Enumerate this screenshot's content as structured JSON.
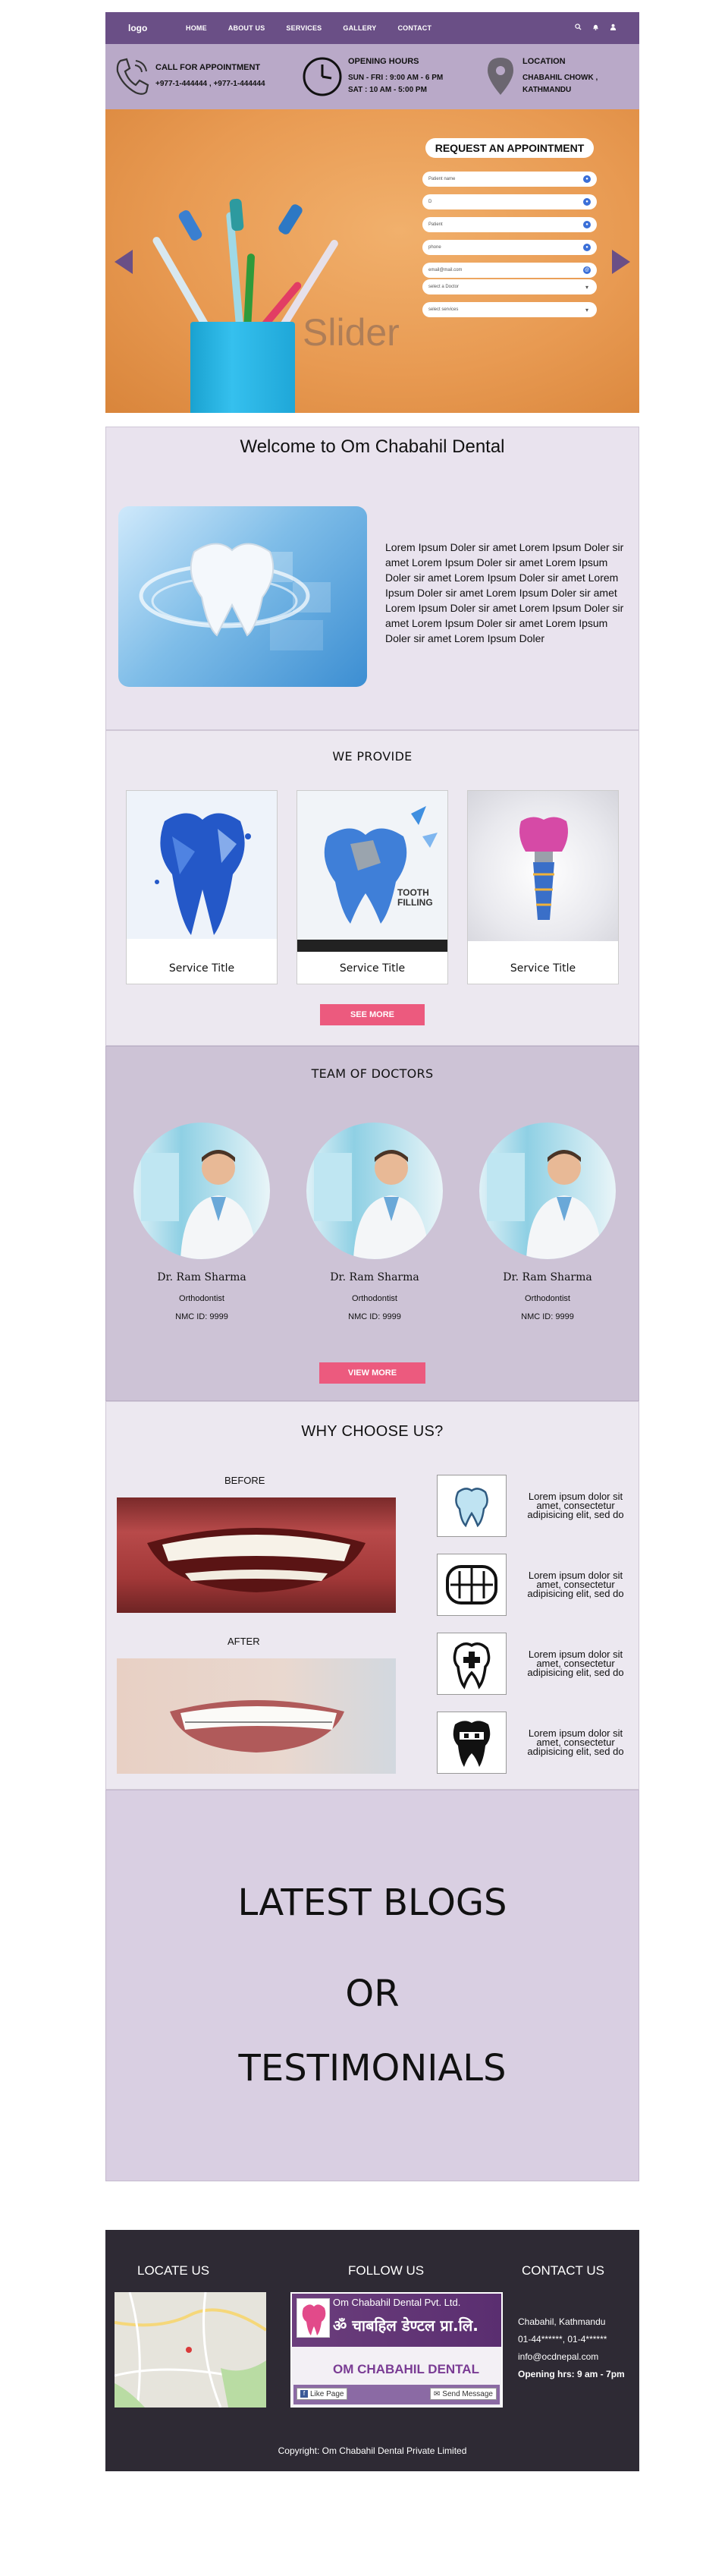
{
  "nav": {
    "logo": "logo",
    "menu": [
      "HOME",
      "ABOUT US",
      "SERVICES",
      "GALLERY",
      "CONTACT"
    ],
    "icons": [
      "search-icon",
      "bell-icon",
      "user-icon"
    ],
    "bg_color": "#6a4f86"
  },
  "info": {
    "call": {
      "title": "CALL FOR APPOINTMENT",
      "line1": "+977-1-444444 , +977-1-444444"
    },
    "hours": {
      "title": "OPENING HOURS",
      "line1": "SUN - FRI : 9:00 AM - 6 PM",
      "line2": "SAT : 10 AM - 5:00 PM"
    },
    "location": {
      "title": "LOCATION",
      "line1": "CHABAHIL CHOWK ,",
      "line2": "KATHMANDU"
    }
  },
  "hero": {
    "slider_label": "Slider",
    "appointment": {
      "heading": "REQUEST AN APPOINTMENT",
      "fields": [
        {
          "placeholder": "Patient name"
        },
        {
          "placeholder": "D"
        },
        {
          "placeholder": "Patient"
        },
        {
          "placeholder": "phone"
        },
        {
          "placeholder": "email@mail.com"
        }
      ],
      "hint": "",
      "selects": [
        {
          "value": "select a Doctor"
        },
        {
          "value": "select services"
        }
      ]
    }
  },
  "welcome": {
    "title": "Welcome to Om Chabahil Dental",
    "body": "Lorem Ipsum Doler sir amet Lorem Ipsum Doler sir amet Lorem Ipsum Doler sir amet Lorem Ipsum Doler sir amet Lorem Ipsum Doler sir amet Lorem Ipsum Doler sir amet Lorem Ipsum Doler sir amet Lorem Ipsum Doler sir amet Lorem Ipsum Doler sir amet Lorem Ipsum Doler sir amet Lorem Ipsum Doler sir amet Lorem Ipsum Doler"
  },
  "provide": {
    "title": "WE PROVIDE",
    "cards": [
      {
        "title": "Service Title",
        "image_caption": ""
      },
      {
        "title": "Service Title",
        "image_caption": "TOOTH FILLING"
      },
      {
        "title": "Service Title",
        "image_caption": ""
      }
    ],
    "button": "SEE MORE"
  },
  "team": {
    "title": "TEAM OF DOCTORS",
    "doctors": [
      {
        "name": "Dr. Ram Sharma",
        "specialty": "Orthodontist",
        "nmc": "NMC ID: 9999"
      },
      {
        "name": "Dr. Ram Sharma",
        "specialty": "Orthodontist",
        "nmc": "NMC ID: 9999"
      },
      {
        "name": "Dr. Ram Sharma",
        "specialty": "Orthodontist",
        "nmc": "NMC ID: 9999"
      }
    ],
    "button": "VIEW MORE"
  },
  "why": {
    "title": "WHY CHOOSE US?",
    "before": "BEFORE",
    "after": "AFTER",
    "reasons": [
      {
        "icon": "tooth-icon",
        "text": "Lorem ipsum dolor sit amet, consectetur adipisicing elit, sed do"
      },
      {
        "icon": "teeth-icon",
        "text": "Lorem ipsum dolor sit amet, consectetur adipisicing elit, sed do"
      },
      {
        "icon": "tooth-cross-icon",
        "text": "Lorem ipsum dolor sit amet, consectetur adipisicing elit, sed do"
      },
      {
        "icon": "braces-tooth-icon",
        "text": "Lorem ipsum dolor sit amet, consectetur adipisicing elit, sed do"
      }
    ]
  },
  "blogs": {
    "line1": "LATEST BLOGS",
    "line2": "OR",
    "line3": "TESTIMONIALS"
  },
  "footer": {
    "locate": "LOCATE US",
    "follow": "FOLLOW US",
    "contact": "CONTACT US",
    "fb": {
      "page_name": "Om Chabahil Dental Pvt. Ltd.",
      "nepali": "ॐ चाबहिल डेण्टल प्रा.लि.",
      "banner": "OM CHABAHIL DENTAL",
      "like": "Like Page",
      "send": "Send Message"
    },
    "contact_lines": [
      "Chabahil, Kathmandu",
      "01-44******, 01-4******",
      "info@ocdnepal.com",
      "Opening hrs: 9 am - 7pm"
    ],
    "copyright": "Copyright: Om Chabahil Dental Private Limited"
  }
}
